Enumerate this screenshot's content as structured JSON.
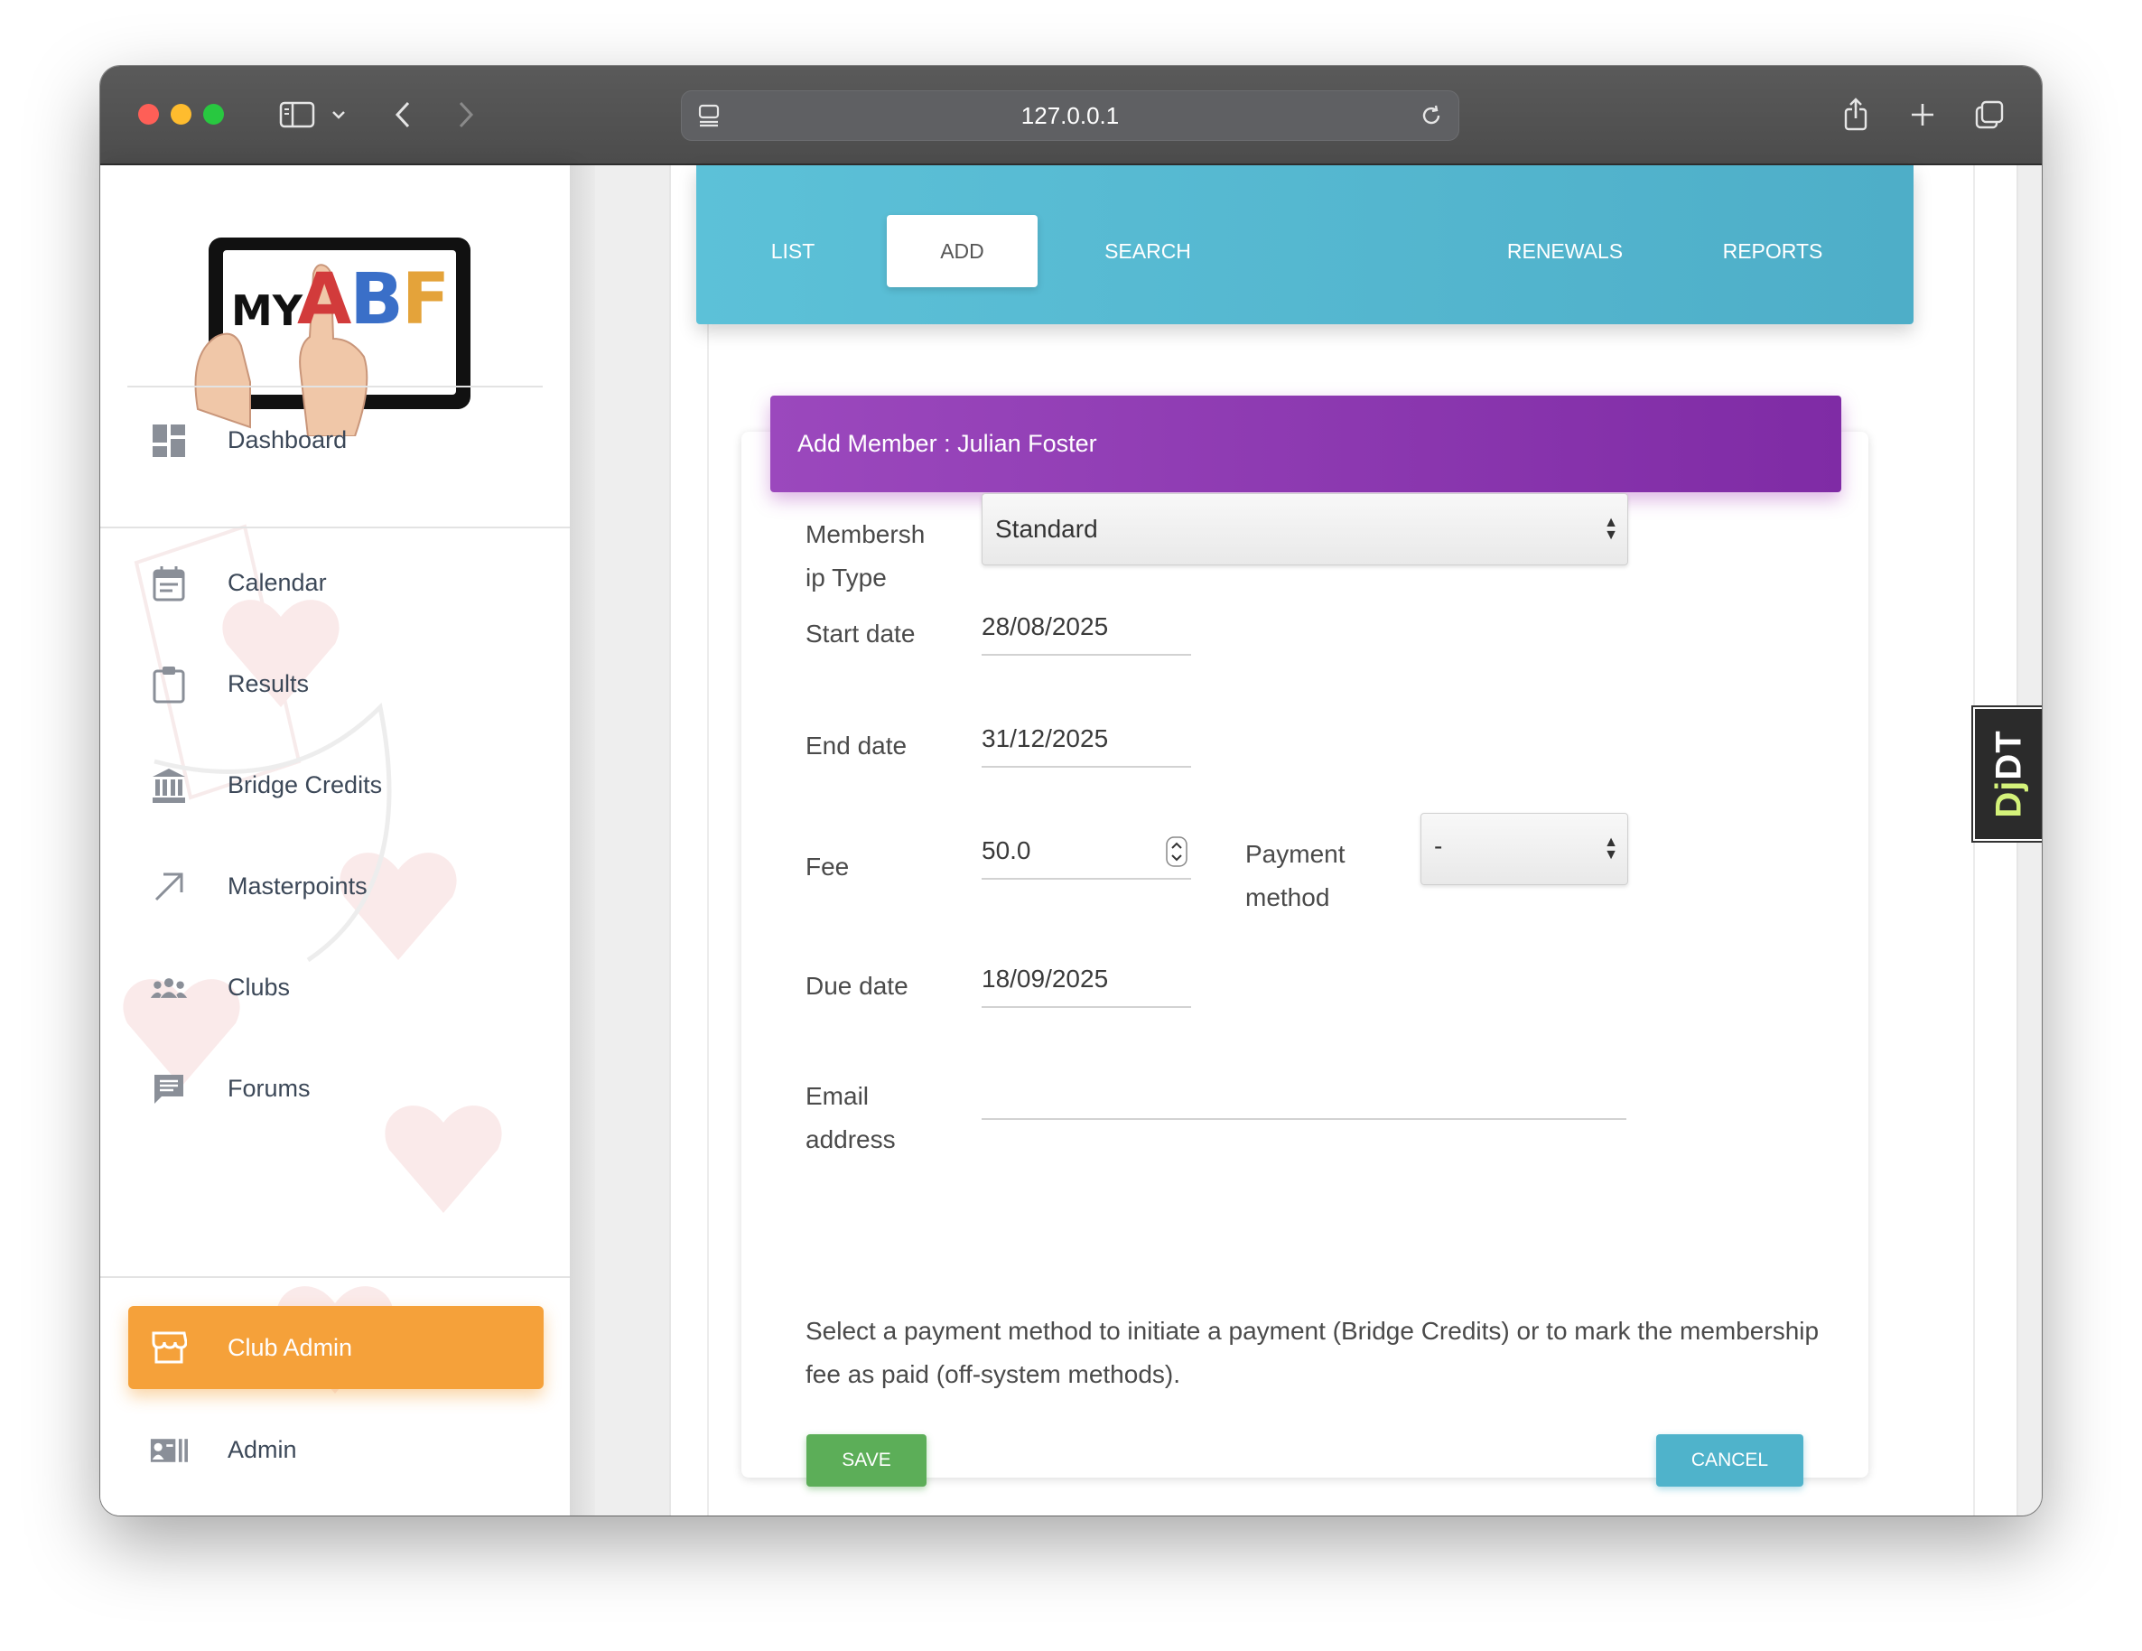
{
  "browser": {
    "url": "127.0.0.1"
  },
  "sidebar": {
    "logo": {
      "text_my": "MY",
      "text_abf": "ABF"
    },
    "items": [
      {
        "label": "Dashboard",
        "icon": "dashboard-icon"
      },
      {
        "label": "Calendar",
        "icon": "calendar-icon"
      },
      {
        "label": "Results",
        "icon": "clipboard-icon"
      },
      {
        "label": "Bridge Credits",
        "icon": "bank-icon"
      },
      {
        "label": "Masterpoints",
        "icon": "arrow-up-right-icon"
      },
      {
        "label": "Clubs",
        "icon": "groups-icon"
      },
      {
        "label": "Forums",
        "icon": "chat-icon"
      },
      {
        "label": "Club Admin",
        "icon": "storefront-icon",
        "active": true
      },
      {
        "label": "Admin",
        "icon": "admin-card-icon"
      }
    ]
  },
  "tabs": [
    {
      "label": "LIST"
    },
    {
      "label": "ADD",
      "active": true
    },
    {
      "label": "SEARCH"
    },
    {
      "label": "RENEWALS"
    },
    {
      "label": "REPORTS"
    }
  ],
  "form": {
    "title": "Add Member : Julian Foster",
    "membership_type": {
      "label_line1": "Membersh",
      "label_line2": "ip Type",
      "value": "Standard"
    },
    "start_date": {
      "label": "Start date",
      "value": "28/08/2025"
    },
    "end_date": {
      "label": "End date",
      "value": "31/12/2025"
    },
    "fee": {
      "label": "Fee",
      "value": "50.0"
    },
    "payment_method": {
      "label_line1": "Payment",
      "label_line2": "method",
      "value": "-"
    },
    "due_date": {
      "label": "Due date",
      "value": "18/09/2025"
    },
    "email": {
      "label_line1": "Email",
      "label_line2": "address",
      "value": ""
    },
    "help_text": "Select a payment method to initiate a payment (Bridge Credits) or to mark the membership fee as paid (off-system methods).",
    "save_label": "SAVE",
    "cancel_label": "CANCEL"
  },
  "debug_toolbar": {
    "text_dj": "Dj",
    "text_dt": "DT"
  },
  "colors": {
    "tab_bar": "#5cc1d8",
    "card_header": "#9b48bd",
    "active_nav": "#f5a13a",
    "save_button": "#5cae58",
    "cancel_button": "#4fb3cb"
  }
}
